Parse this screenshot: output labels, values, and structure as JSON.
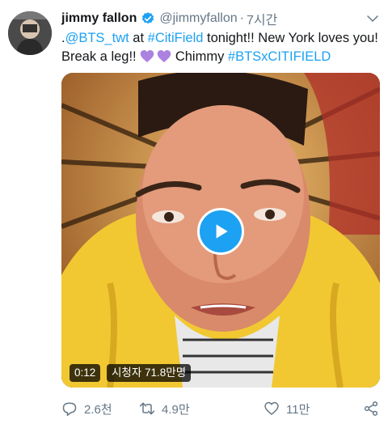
{
  "tweet": {
    "author_name": "jimmy fallon",
    "handle": "@jimmyfallon",
    "separator": "·",
    "time": "7시간",
    "text_parts": [
      {
        "text": ".",
        "type": "plain"
      },
      {
        "text": "@BTS_twt",
        "type": "link"
      },
      {
        "text": " at ",
        "type": "plain"
      },
      {
        "text": "#CitiField",
        "type": "link"
      },
      {
        "text": " tonight!! New York loves you! Break a leg!! ",
        "type": "plain"
      },
      {
        "text": " Chimmy ",
        "type": "plain"
      },
      {
        "text": "#BTSxCITIFIELD",
        "type": "link"
      }
    ],
    "emoji": "purple-heart"
  },
  "video": {
    "duration": "0:12",
    "views": "시청자 71.8만명"
  },
  "actions": {
    "replies": "2.6천",
    "retweets": "4.9만",
    "likes": "11만"
  },
  "colors": {
    "link": "#1da1f2",
    "secondary": "#657786",
    "verified": "#1da1f2",
    "heart": "#ab82e0"
  }
}
